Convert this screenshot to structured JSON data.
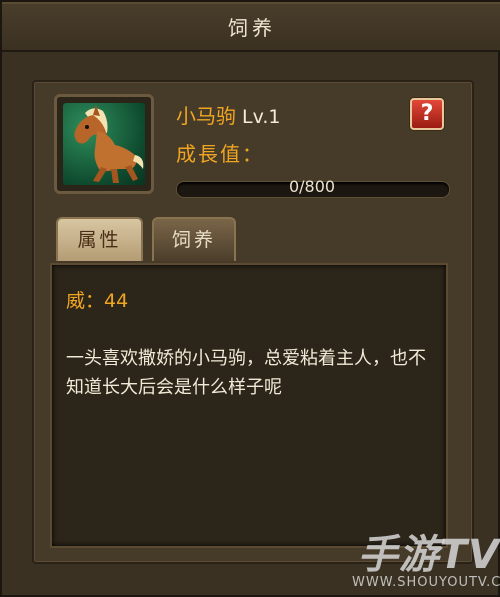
{
  "window": {
    "title": "饲养"
  },
  "pet": {
    "name": "小马驹",
    "level": "Lv.1",
    "portrait_icon": "horse-portrait-icon"
  },
  "growth": {
    "label": "成長值：",
    "current": 0,
    "max": 800,
    "progress_text": "0/800",
    "fraction": 0
  },
  "help": {
    "label": "?",
    "icon": "question-mark-icon"
  },
  "tabs": [
    {
      "label": "属性",
      "active": true
    },
    {
      "label": "饲养",
      "active": false
    }
  ],
  "attributes": {
    "stat_label": "威：",
    "stat_value": "44"
  },
  "description": "一头喜欢撒娇的小马驹，总爱粘着主人，也不知道长大后会是什么样子呢",
  "watermark": {
    "logo": "手游TV",
    "url": "WWW.SHOUYOUTV.COM"
  },
  "colors": {
    "accent_orange": "#f0a623",
    "text_light": "#f1ead6",
    "help_red": "#c8291b",
    "panel_bg": "#463a29"
  }
}
